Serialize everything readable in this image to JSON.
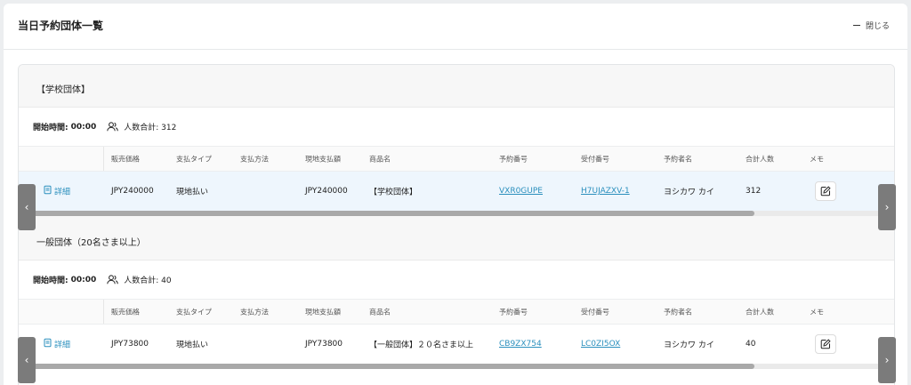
{
  "header": {
    "title": "当日予約団体一覧",
    "close_label": "閉じる"
  },
  "columns": [
    "販売価格",
    "支払タイプ",
    "支払方法",
    "現地支払額",
    "商品名",
    "予約番号",
    "受付番号",
    "予約者名",
    "合計人数",
    "メモ"
  ],
  "groups": [
    {
      "name": "【学校団体】",
      "start_label": "開始時間:",
      "start_time": "00:00",
      "people_total": "人数合計: 312",
      "row": {
        "detail_label": "詳細",
        "price": "JPY240000",
        "pay_type": "現地払い",
        "pay_method": "",
        "onsite_amount": "JPY240000",
        "product": "【学校団体】",
        "reservation_no": "VXR0GUPE",
        "receipt_no": "H7UJAZXV-1",
        "booker": "ヨシカワ カイ",
        "total_people": "312"
      },
      "scroll_fraction": 0.84
    },
    {
      "name": "一般団体（20名さま以上）",
      "start_label": "開始時間:",
      "start_time": "00:00",
      "people_total": "人数合計: 40",
      "row": {
        "detail_label": "詳細",
        "price": "JPY73800",
        "pay_type": "現地払い",
        "pay_method": "",
        "onsite_amount": "JPY73800",
        "product": "【一般団体】２０名さま以上",
        "reservation_no": "CB9ZX754",
        "receipt_no": "LC0ZI5OX",
        "booker": "ヨシカワ カイ",
        "total_people": "40"
      },
      "scroll_fraction": 0.84
    }
  ],
  "icons": {
    "close": "minus-icon",
    "people": "people-icon",
    "detail": "document-icon",
    "memo": "edit-icon",
    "scroll_left": "chevron-left-icon",
    "scroll_right": "chevron-right-icon"
  },
  "colors": {
    "link": "#2a8fbd",
    "row_highlight": "#eef6fd"
  }
}
